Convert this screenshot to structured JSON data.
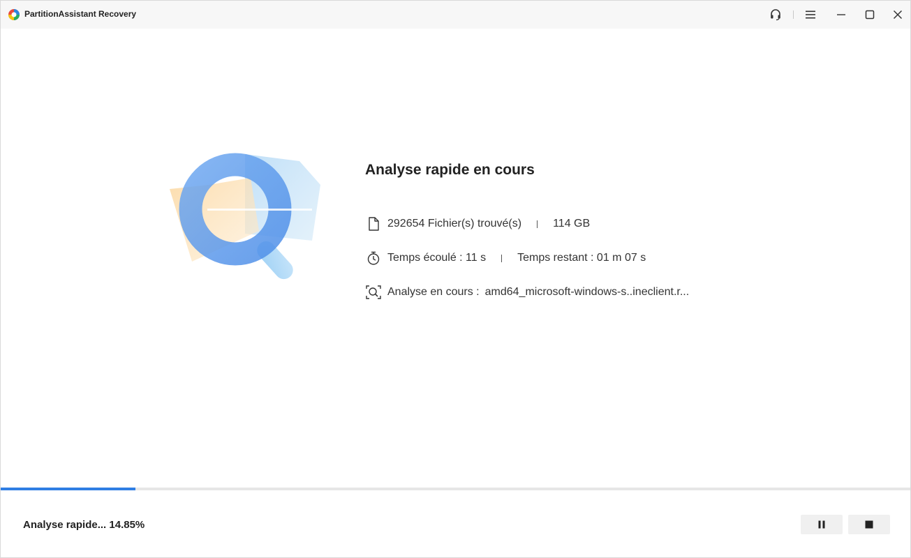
{
  "app": {
    "title": "PartitionAssistant Recovery",
    "logo_icon": "partitionassistant-logo-icon"
  },
  "titlebar": {
    "buttons": [
      "headset-support-icon",
      "menu-icon",
      "minimize-icon",
      "maximize-icon",
      "close-icon"
    ]
  },
  "illustration": {
    "icon": "magnifier-folder-illustration"
  },
  "scan": {
    "title": "Analyse rapide en cours",
    "files_found": "292654 Fichier(s) trouvé(s)",
    "size": "114 GB",
    "elapsed": "Temps écoulé : 11 s",
    "remaining": "Temps restant : 01 m 07 s",
    "current_label": "Analyse en cours :",
    "current_file": "amd64_microsoft-windows-s..ineclient.r..."
  },
  "progress": {
    "percent": 14.85,
    "status_text": "Analyse rapide... 14.85%"
  },
  "controls": {
    "pause_icon": "pause-icon",
    "stop_icon": "stop-icon"
  },
  "colors": {
    "accent": "#2f7ee3",
    "titlebar_bg": "#f7f7f7",
    "button_bg": "#f0f0f0"
  }
}
